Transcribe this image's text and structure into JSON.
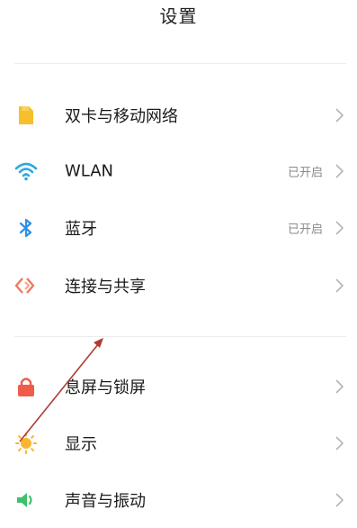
{
  "header": {
    "title": "设置"
  },
  "sections": [
    {
      "items": [
        {
          "label": "双卡与移动网络",
          "status": "",
          "icon": "sim-card-icon",
          "icon_color": "#F5C02A"
        },
        {
          "label": "WLAN",
          "status": "已开启",
          "icon": "wifi-icon",
          "icon_color": "#2EA8E0"
        },
        {
          "label": "蓝牙",
          "status": "已开启",
          "icon": "bluetooth-icon",
          "icon_color": "#2E8FE3"
        },
        {
          "label": "连接与共享",
          "status": "",
          "icon": "share-connection-icon",
          "icon_color": "#E97A5F"
        }
      ]
    },
    {
      "items": [
        {
          "label": "息屏与锁屏",
          "status": "",
          "icon": "lock-icon",
          "icon_color": "#F05B4C"
        },
        {
          "label": "显示",
          "status": "",
          "icon": "sun-icon",
          "icon_color": "#F7B731"
        },
        {
          "label": "声音与振动",
          "status": "",
          "icon": "speaker-icon",
          "icon_color": "#3CC26C"
        }
      ]
    }
  ],
  "annotation": {
    "type": "red-arrow",
    "color": "#B03A34",
    "points_to": "显示"
  }
}
